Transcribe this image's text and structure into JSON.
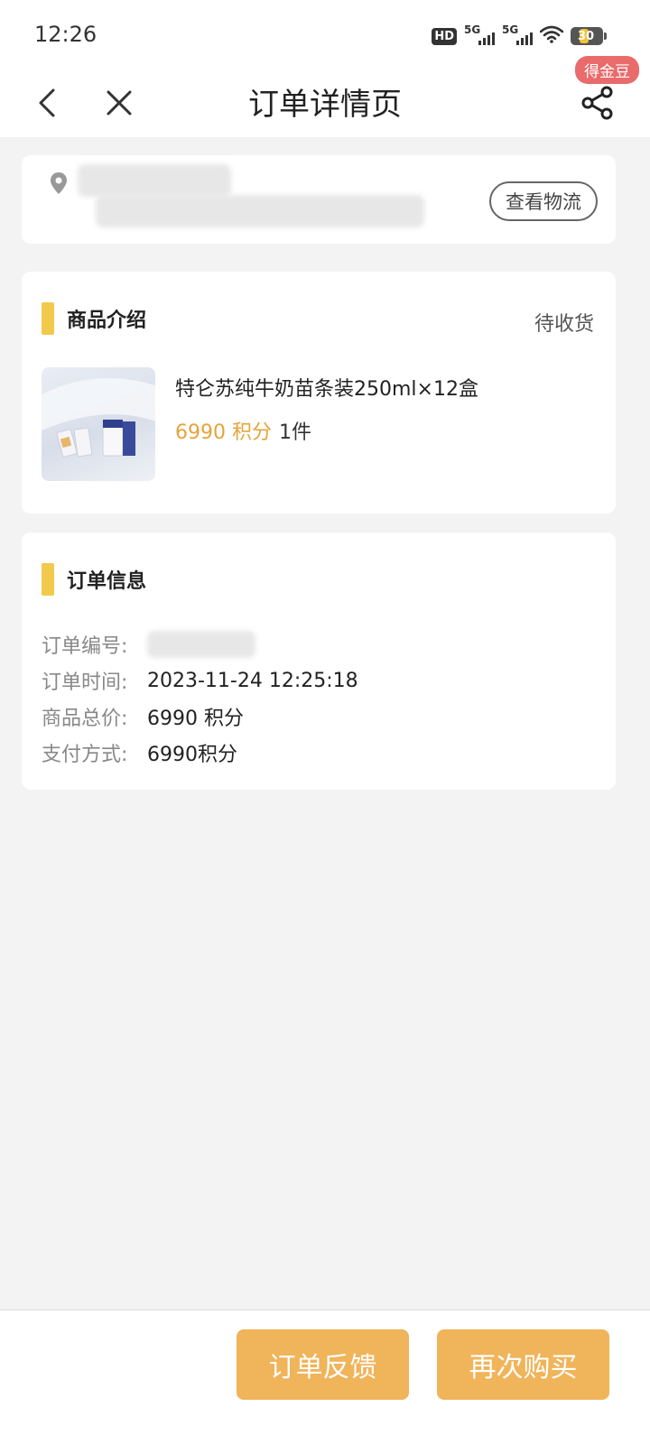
{
  "status_bar": {
    "time": "12:26",
    "hd_label": "HD",
    "network_1": "5G",
    "network_2": "5G",
    "battery": "30"
  },
  "nav": {
    "title": "订单详情页",
    "badge": "得金豆"
  },
  "address": {
    "logistics_label": "查看物流"
  },
  "product_section": {
    "title": "商品介绍",
    "status": "待收货",
    "product_name": "特仑苏纯牛奶苗条装250ml×12盒",
    "price": "6990 积分",
    "quantity": "1件"
  },
  "order_info": {
    "title": "订单信息",
    "rows": [
      {
        "label": "订单编号:",
        "value": ""
      },
      {
        "label": "订单时间:",
        "value": "2023-11-24 12:25:18"
      },
      {
        "label": "商品总价:",
        "value": "6990 积分"
      },
      {
        "label": "支付方式:",
        "value": "6990积分"
      }
    ]
  },
  "actions": {
    "feedback": "订单反馈",
    "rebuy": "再次购买"
  },
  "colors": {
    "accent": "#f0b45a",
    "price": "#e5a43b",
    "section_bar": "#f2c94c",
    "badge": "#e96b6b"
  }
}
